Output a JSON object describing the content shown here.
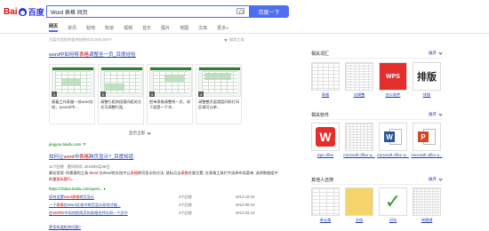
{
  "header": {
    "logo_text_left": "Bai",
    "logo_text_right": "百度",
    "query": "Word 表格 间页",
    "search_button": "百度一下"
  },
  "tabs": [
    "网页",
    "资讯",
    "贴吧",
    "知道",
    "视频",
    "音乐",
    "图片",
    "地图",
    "文库",
    "更多»"
  ],
  "result_count": "百度为您找到相关结果约22,500,000个",
  "search_tools": "搜索工具",
  "result1": {
    "title_prefix": "word",
    "title_mid1": "中如何将",
    "title_hl": "表格",
    "title_rest": "调整至一页_百度经验",
    "steps": [
      {
        "num": "1",
        "text": "随着工作表量一份word文档，从excel中..."
      },
      {
        "num": "2",
        "text": "调整行距和段落间距的方式可调整行距..."
      },
      {
        "num": "3",
        "text": "把单表格调整到一页，如下面是一个合..."
      },
      {
        "num": "4",
        "text": "调整整页面宽度同样打印区域可以单..."
      }
    ],
    "show_all": "显示全部",
    "url": "jingyan.baidu.com"
  },
  "result2": {
    "title_prefix": "如何让",
    "title_word": "word",
    "title_mid": "中",
    "title_hl": "表格",
    "title_rest": "跨页显示?_百度知道",
    "meta": "11个回答 · 提问时间: 2016年6月28日",
    "snippet_a": "最佳答案: 所需要的工具 ",
    "snippet_hl1": "Word",
    "snippet_b": " 在Word的文档中让",
    "snippet_hl2": "表格",
    "snippet_c": "跨页显示的方法: 鼠标点击",
    "snippet_hl3": "表格",
    "snippet_d": "任意位置, 在表格工具栏中选择布局菜单, 选择数据组中的",
    "snippet_hl4": "重复标题行",
    "snippet_e": "。",
    "source": "https://zhidao.baidu.com/quest... ▾",
    "qa": [
      {
        "pre": "如何设置",
        "hl": "word表格",
        "post": "跨页显示",
        "answers": "3个回答",
        "date": "2014-10-24"
      },
      {
        "pre": "一个",
        "hl": "表格",
        "post": "在Word文档中跨页显示如何才能...",
        "answers": "3个回答",
        "date": "2013-06-24"
      },
      {
        "pre": "在",
        "hl": "WORD",
        "post": "中如何把两页的表格合并在同一个页中",
        "answers": "2个回答",
        "date": "2012-04-13"
      }
    ],
    "more": "更多知道相关问题>"
  },
  "right_panel": {
    "section1": {
      "title": "相关词汇",
      "toggle": "展开",
      "items": [
        {
          "label": "表格"
        },
        {
          "label": "对调整"
        },
        {
          "label": "办公软件"
        },
        {
          "label": "排版"
        }
      ]
    },
    "section2": {
      "title": "相关软件",
      "toggle": "展开",
      "items": [
        {
          "label": "wps office"
        },
        {
          "label": "microsoft office w..."
        },
        {
          "label": "microsoft office w..."
        },
        {
          "label": "microsoft office p..."
        }
      ]
    },
    "section3": {
      "title": "其他人还搜",
      "toggle": "展开",
      "items": [
        {
          "label": "单元格"
        },
        {
          "label": "文档"
        },
        {
          "label": "对勾"
        },
        {
          "label": "快捷键"
        }
      ]
    },
    "paiban_glyph": "排版",
    "wps_glyph": "WPS",
    "w_glyph": "W",
    "word_badge": "W",
    "ppt_badge": "P",
    "check_glyph": "✓",
    "word_badge_color": "#2b579a",
    "ppt_badge_color": "#d24726"
  }
}
